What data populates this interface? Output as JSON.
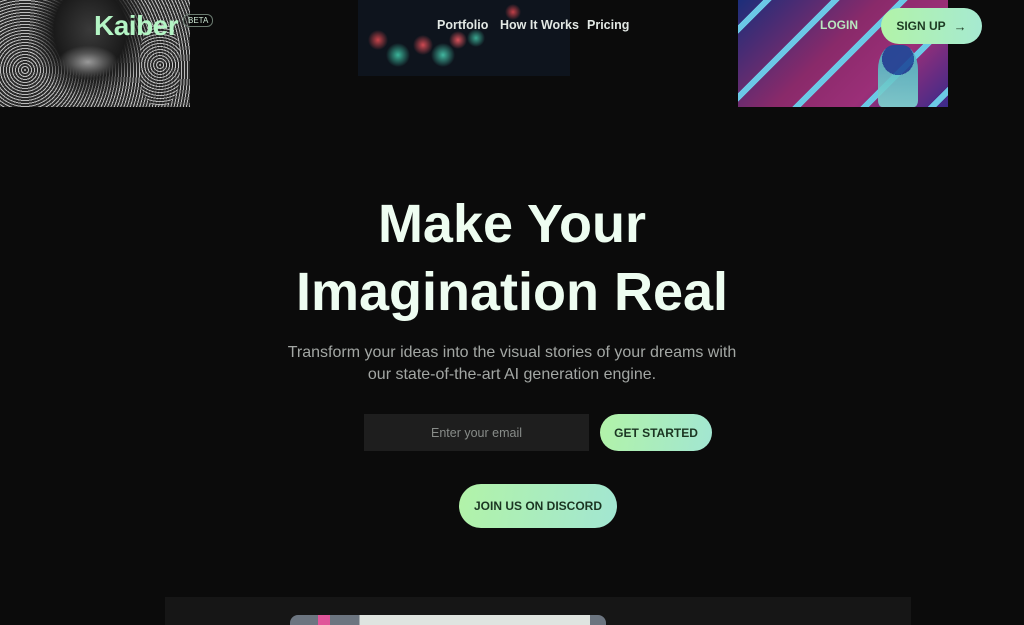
{
  "brand": {
    "name": "Kaiber",
    "badge": "BETA",
    "accent_color": "#b4f5c5"
  },
  "nav": {
    "links": [
      {
        "label": "Portfolio"
      },
      {
        "label": "How It Works"
      },
      {
        "label": "Pricing"
      }
    ],
    "login_label": "LOGIN",
    "signup_label": "SIGN UP",
    "signup_icon": "arrow-right-icon"
  },
  "hero": {
    "title_line1": "Make Your",
    "title_line2": "Imagination Real",
    "subtitle_line1": "Transform your ideas into the visual stories of your dreams with",
    "subtitle_line2": "our state-of-the-art AI generation engine.",
    "email_placeholder": "Enter your email",
    "email_value": "",
    "get_started_label": "GET STARTED",
    "discord_label": "JOIN US ON DISCORD"
  },
  "colors": {
    "background": "#0b0b0b",
    "button_gradient_start": "#b2f3a8",
    "button_gradient_end": "#a2e6d2",
    "button_text": "#1b3522"
  }
}
